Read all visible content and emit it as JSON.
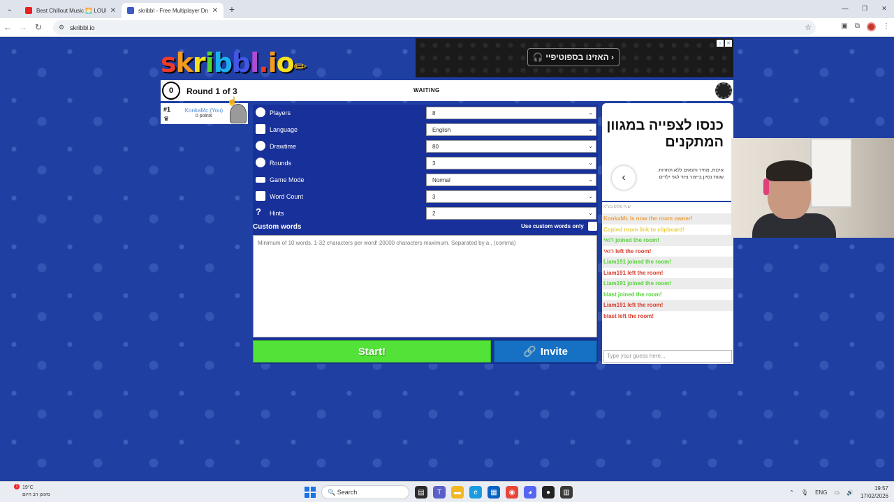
{
  "browser": {
    "tabs": [
      {
        "title": "Best Chillout Music 🌅 LOUNGE",
        "favicon_color": "#e52222"
      },
      {
        "title": "skribbl - Free Multiplayer Draw",
        "favicon_color": "#3b5bc4"
      }
    ],
    "url": "skribbl.io"
  },
  "ad_top": {
    "button_label": "🎧 האזינו בספוטיפיי ›"
  },
  "game": {
    "round_number": "0",
    "round_text": "Round 1 of 3",
    "status": "WAITING"
  },
  "player": {
    "rank": "#1",
    "name": "KonkaMc (You)",
    "points": "0 points"
  },
  "settings": {
    "rows": [
      {
        "label": "Players",
        "value": "8"
      },
      {
        "label": "Language",
        "value": "English"
      },
      {
        "label": "Drawtime",
        "value": "80"
      },
      {
        "label": "Rounds",
        "value": "3"
      },
      {
        "label": "Game Mode",
        "value": "Normal"
      },
      {
        "label": "Word Count",
        "value": "3"
      },
      {
        "label": "Hints",
        "value": "2"
      }
    ],
    "custom_words_label": "Custom words",
    "custom_only_label": "Use custom words only",
    "words_placeholder": "Minimum of 10 words. 1-32 characters per word! 20000 characters maximum. Separated by a , (comma)",
    "start_label": "Start!",
    "invite_label": "Invite"
  },
  "ad_right": {
    "headline": "כנסו לצפייה במגוון המתקנים",
    "description": "איכות, מחיר ותנאים ללא תחרות. שנות נסיון בייצור ציוד לגני ילדים"
  },
  "chat": {
    "header": "ש.ח פלוס בע\"מ",
    "messages": [
      {
        "text": "KonkaMc is now the room owner!",
        "color": "#f0a040"
      },
      {
        "text": "Copied room link to clipboard!",
        "color": "#e8d040"
      },
      {
        "text": "רואי joined the room!",
        "color": "#53d437"
      },
      {
        "text": "רואי left the room!",
        "color": "#d73a2a"
      },
      {
        "text": "Liam191 joined the room!",
        "color": "#53d437"
      },
      {
        "text": "Liam191 left the room!",
        "color": "#d73a2a"
      },
      {
        "text": "Liam191 joined the room!",
        "color": "#53d437"
      },
      {
        "text": "blast joined the room!",
        "color": "#53d437"
      },
      {
        "text": "Liam191 left the room!",
        "color": "#d73a2a"
      },
      {
        "text": "blast left the room!",
        "color": "#d73a2a"
      }
    ],
    "guess_placeholder": "Type your guess here..."
  },
  "taskbar": {
    "weather_temp": "19°C",
    "weather_desc": "מעונן רב היום",
    "notif_count": "1",
    "search_label": "Search",
    "lang": "ENG",
    "time": "19:57",
    "date": "17/02/2026"
  }
}
